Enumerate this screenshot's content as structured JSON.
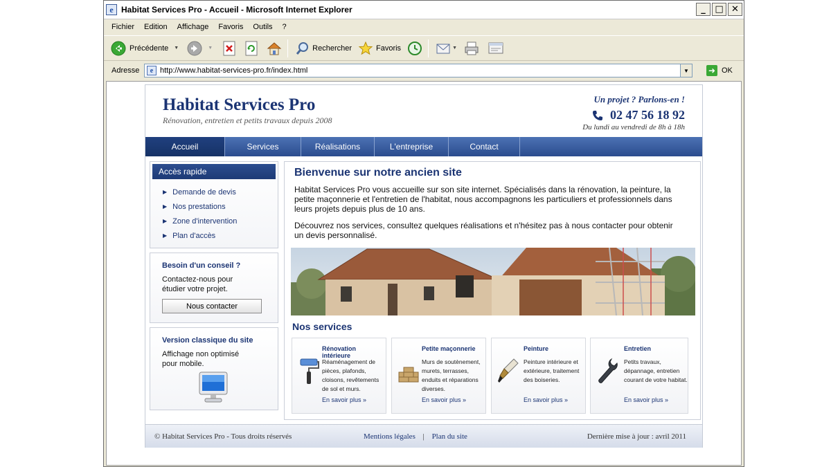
{
  "window": {
    "title": "Habitat Services Pro - Accueil - Microsoft Internet Explorer",
    "controls": [
      "_",
      "□",
      "✕"
    ]
  },
  "menu": [
    "Fichier",
    "Edition",
    "Affichage",
    "Favoris",
    "Outils",
    "?"
  ],
  "toolbar": {
    "back_label": "Précédente",
    "search_label": "Rechercher",
    "favorites_label": "Favoris"
  },
  "address": {
    "label": "Adresse",
    "url": "http://www.habitat-services-pro.fr/index.html",
    "go_label": "OK"
  },
  "site": {
    "name": "Habitat Services Pro",
    "tagline": "Rénovation, entretien et petits travaux depuis 2008",
    "slogan": "Un projet ? Parlons-en !",
    "phone": "02 47 56 18 92",
    "hours": "Du lundi au vendredi de 8h à 18h"
  },
  "nav": {
    "items": [
      "Accueil",
      "Services",
      "Réalisations",
      "L'entreprise",
      "Contact"
    ],
    "active": "Accueil"
  },
  "quick_access": {
    "title": "Accès rapide",
    "items": [
      "Demande de devis",
      "Nos prestations",
      "Zone d'intervention",
      "Plan d'accès"
    ]
  },
  "advice": {
    "title": "Besoin d'un conseil ?",
    "text": "Contactez-nous pour étudier votre projet.",
    "button": "Nous contacter"
  },
  "classic": {
    "title": "Version classique du site",
    "text": "Affichage non optimisé pour mobile."
  },
  "main": {
    "title": "Bienvenue sur notre ancien site",
    "p1": "Habitat Services Pro vous accueille sur son site internet. Spécialisés dans la rénovation, la peinture, la petite maçonnerie et l'entretien de l'habitat, nous accompagnons les particuliers et professionnels dans leurs projets depuis plus de 10 ans.",
    "p2": "Découvrez nos services, consultez quelques réalisations et n'hésitez pas à nous contacter pour obtenir un devis personnalisé."
  },
  "services": {
    "title": "Nos services",
    "cards": [
      {
        "title": "Rénovation intérieure",
        "desc": "Réaménagement de pièces, plafonds, cloisons, revêtements de sol et murs.",
        "link": "En savoir plus »",
        "icon": "paint-roller-icon"
      },
      {
        "title": "Petite maçonnerie",
        "desc": "Murs de soutènement, murets, terrasses, enduits et réparations diverses.",
        "link": "En savoir plus »",
        "icon": "bricks-icon"
      },
      {
        "title": "Peinture",
        "desc": "Peinture intérieure et extérieure, traitement des boiseries.",
        "link": "En savoir plus »",
        "icon": "paintbrush-icon"
      },
      {
        "title": "Entretien",
        "desc": "Petits travaux, dépannage, entretien courant de votre habitat.",
        "link": "En savoir plus »",
        "icon": "wrench-icon"
      }
    ]
  },
  "footer": {
    "copyright": "© Habitat Services Pro - Tous droits réservés",
    "link1": "Mentions légales",
    "separator": "|",
    "link2": "Plan du site",
    "updated": "Dernière mise à jour : avril 2011"
  },
  "colors": {
    "brand": "#1b3473",
    "nav": "#2b4c8e"
  }
}
